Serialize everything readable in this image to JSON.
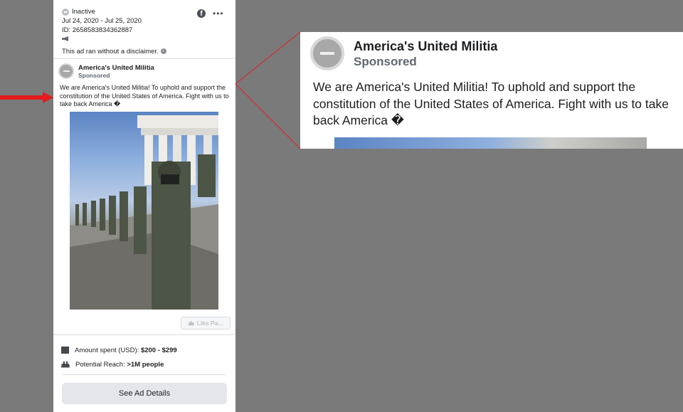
{
  "ad": {
    "status": "Inactive",
    "dates": "Jul 24, 2020 - Jul 25, 2020",
    "id": "ID: 2658583834362887",
    "disclaimer": "This ad ran without a disclaimer.",
    "advertiser": "America's United Militia",
    "sponsored": "Sponsored",
    "body": "We are America's United Militia! To uphold and support the constitution of the United States of America. Fight with us to take back America �",
    "like_label": "Like Pa...",
    "amount_label": "Amount spent (USD):",
    "amount_value": "$200 - $299",
    "reach_label": "Potential Reach:",
    "reach_value": ">1M people",
    "details_button": "See Ad Details"
  },
  "zoom": {
    "advertiser": "America's United Militia",
    "sponsored": "Sponsored",
    "body": "We are America's United Militia! To uphold and support the constitution of the United States of America. Fight with us to take back America �"
  },
  "icons": {
    "status": "inactive-status-icon",
    "platform": "facebook-icon",
    "menu": "more-options-icon",
    "megaphone": "megaphone-icon",
    "info": "info-icon",
    "like": "thumbs-up-icon",
    "amount": "receipt-icon",
    "reach": "people-icon",
    "pointer": "red-arrow-icon"
  },
  "colors": {
    "background": "#7a7a7a",
    "card": "#ffffff",
    "highlight": "#e02020",
    "button": "#e4e6eb"
  }
}
